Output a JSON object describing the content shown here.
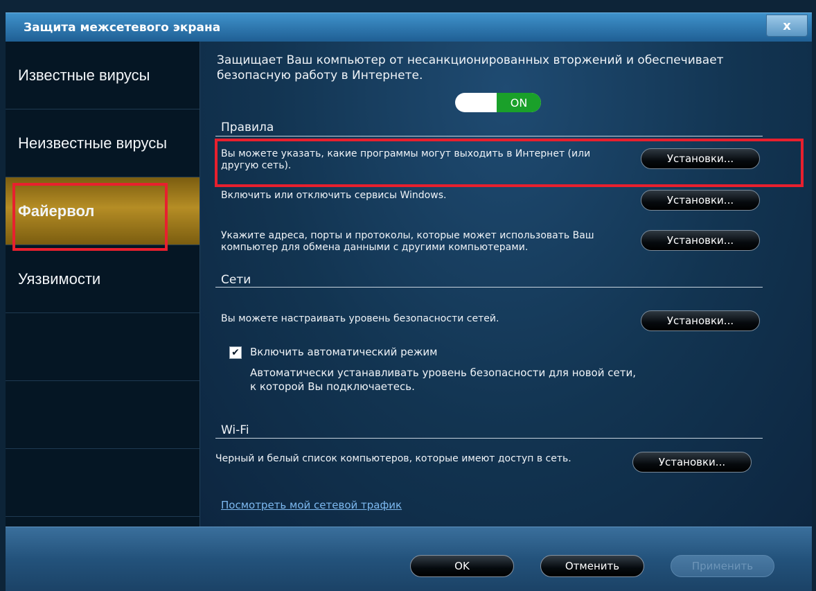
{
  "window": {
    "title": "Защита межсетевого экрана",
    "close_label": "x"
  },
  "sidebar": {
    "items": [
      {
        "label": "Известные вирусы"
      },
      {
        "label": "Неизвестные вирусы"
      },
      {
        "label": "Файервол"
      },
      {
        "label": "Уязвимости"
      }
    ]
  },
  "main": {
    "description": "Защищает Ваш компьютер от несанкционированных вторжений и обеспечивает безопасную работу в Интернете.",
    "toggle_state": "ON",
    "rules": {
      "heading": "Правила",
      "rows": [
        {
          "text": "Вы можете указать, какие программы могут выходить в Интернет (или другую сеть).",
          "button": "Установки..."
        },
        {
          "text": "Включить или отключить сервисы Windows.",
          "button": "Установки..."
        },
        {
          "text": "Укажите адреса, порты и протоколы, которые может использовать Ваш компьютер для обмена данными с другими компьютерами.",
          "button": "Установки..."
        }
      ]
    },
    "networks": {
      "heading": "Сети",
      "row": {
        "text": "Вы можете настраивать уровень безопасности сетей.",
        "button": "Установки..."
      },
      "auto_mode_checkbox": {
        "label": "Включить автоматический режим",
        "checked": true
      },
      "auto_mode_description": "Автоматически устанавливать уровень безопасности для новой сети, к которой Вы подключаетесь."
    },
    "wifi": {
      "heading": "Wi-Fi",
      "row": {
        "text": "Черный и белый список компьютеров, которые имеют доступ в сеть.",
        "button": "Установки..."
      }
    },
    "traffic_link": "Посмотреть мой сетевой трафик"
  },
  "footer": {
    "ok": "OK",
    "cancel": "Отменить",
    "apply": "Применить"
  },
  "colors": {
    "highlight": "#e8202e",
    "toggle_on": "#1aa02a",
    "active_sidebar": "#b58d25",
    "link": "#7db9f0"
  }
}
